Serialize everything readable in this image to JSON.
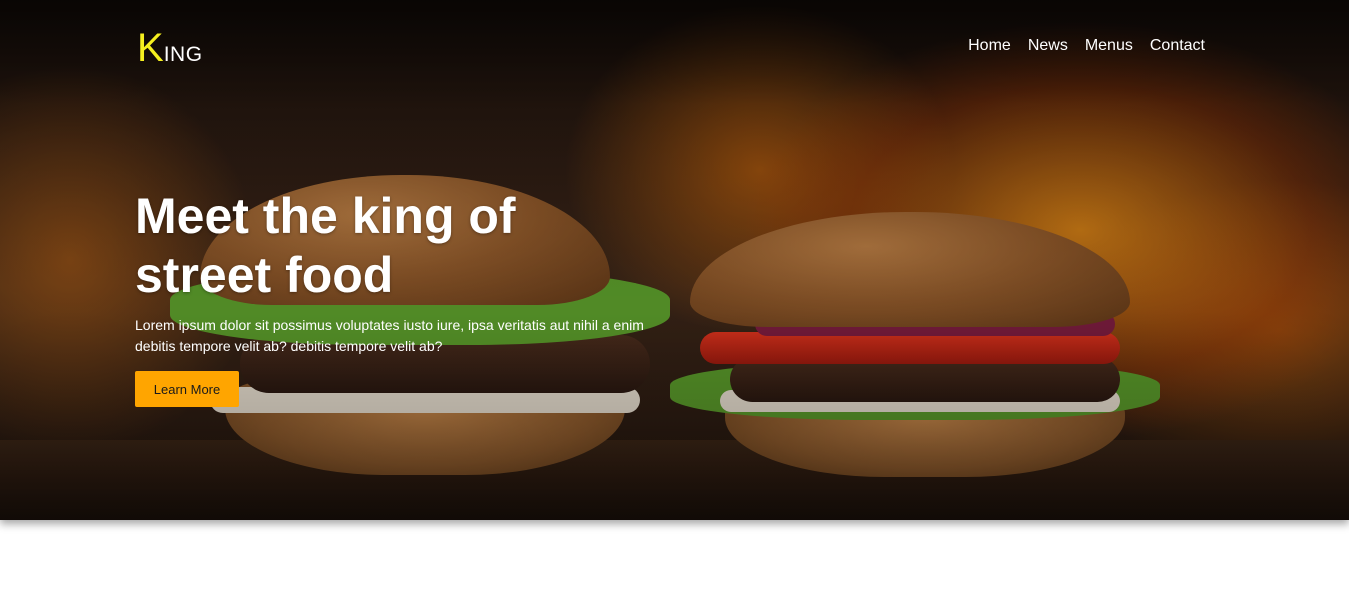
{
  "brand": {
    "initial": "K",
    "rest": "ING"
  },
  "nav": {
    "items": [
      {
        "label": "Home"
      },
      {
        "label": "News"
      },
      {
        "label": "Menus"
      },
      {
        "label": "Contact"
      }
    ]
  },
  "hero": {
    "title_line1": "Meet the king of",
    "title_line2": "street food",
    "text": "Lorem ipsum dolor sit possimus voluptates iusto iure, ipsa veritatis aut nihil a enim debitis tempore velit ab? debitis tempore velit ab?",
    "button_label": "Learn More",
    "image": "burgers-with-flames"
  },
  "colors": {
    "accent": "#ffa500",
    "logo": "#f5ef1f",
    "text": "#ffffff"
  }
}
